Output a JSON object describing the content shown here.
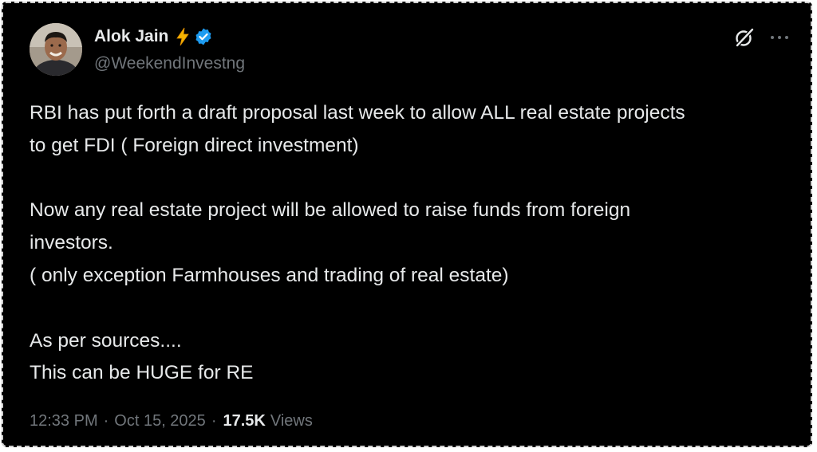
{
  "author": {
    "display_name": "Alok Jain",
    "handle": "@WeekendInvestng",
    "avatar_icon": "person-avatar-icon",
    "badge_emoji": "⚡",
    "verified_color": "#1d9bf0"
  },
  "header_actions": {
    "grok_icon": "grok-icon",
    "more_icon": "more-options-icon"
  },
  "tweet": {
    "text": "RBI has put forth a draft proposal last week to allow ALL real estate projects\nto get FDI ( Foreign direct investment)\n\nNow any real estate project will be allowed to raise funds from foreign\ninvestors.\n( only exception Farmhouses and trading of real estate)\n\nAs per sources....\nThis can be HUGE for RE"
  },
  "meta": {
    "time": "12:33 PM",
    "separator_1": "·",
    "date": "Oct 15, 2025",
    "separator_2": "·",
    "views_count": "17.5K",
    "views_label": "Views"
  },
  "colors": {
    "background": "#000000",
    "text_primary": "#e7e9ea",
    "text_secondary": "#71767b",
    "accent": "#1d9bf0"
  }
}
